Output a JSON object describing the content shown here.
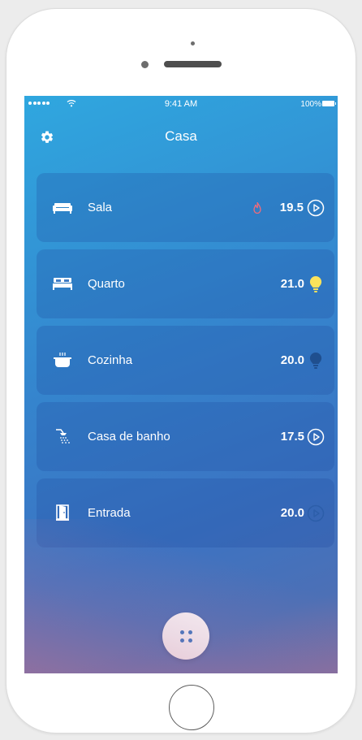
{
  "status_bar": {
    "time": "9:41 AM",
    "battery": "100%",
    "signal_icon": "signal-dots-icon",
    "wifi_icon": "wifi-icon"
  },
  "header": {
    "title": "Casa",
    "settings_icon": "gear-icon"
  },
  "rooms": [
    {
      "name": "Sala",
      "temperature": "19.5",
      "icon": "sofa-icon",
      "heating": true,
      "status_icon": "play-circle-icon"
    },
    {
      "name": "Quarto",
      "temperature": "21.0",
      "icon": "bed-icon",
      "heating": false,
      "status_icon": "lightbulb-on-icon"
    },
    {
      "name": "Cozinha",
      "temperature": "20.0",
      "icon": "cooking-pot-icon",
      "heating": false,
      "status_icon": "lightbulb-off-icon"
    },
    {
      "name": "Casa de banho",
      "temperature": "17.5",
      "icon": "shower-icon",
      "heating": false,
      "status_icon": "play-circle-icon"
    },
    {
      "name": "Entrada",
      "temperature": "20.0",
      "icon": "door-icon",
      "heating": false,
      "status_icon": "play-circle-dim-icon"
    }
  ],
  "fab": {
    "icon": "grid-dots-icon"
  },
  "colors": {
    "bulb_on": "#fbe35b",
    "bulb_off": "#1f4f8f",
    "flame": "#f26b7a",
    "accent": "#3578c6"
  }
}
